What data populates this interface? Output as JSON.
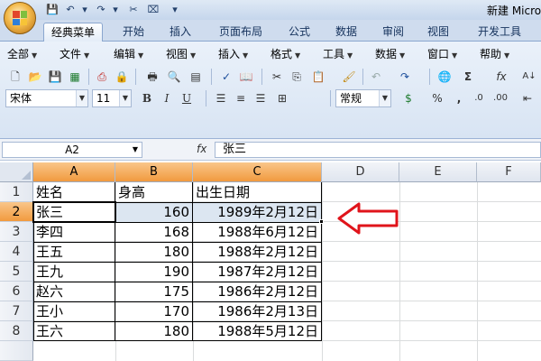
{
  "window": {
    "title": "新建 Micro"
  },
  "tabs": [
    "经典菜单",
    "开始",
    "插入",
    "页面布局",
    "公式",
    "数据",
    "审阅",
    "视图",
    "开发工具"
  ],
  "menus": [
    "全部",
    "文件",
    "编辑",
    "视图",
    "插入",
    "格式",
    "工具",
    "数据",
    "窗口",
    "帮助"
  ],
  "toolbar": {
    "font": "宋体",
    "size": "11",
    "bold": "B",
    "italic": "I",
    "underline": "U",
    "number_format": "常规",
    "percent": "%",
    "comma": ",",
    "fx": "fx"
  },
  "formula_bar": {
    "name_box": "A2",
    "fx_label": "fx",
    "value": "张三"
  },
  "grid": {
    "columns": [
      "A",
      "B",
      "C",
      "D",
      "E",
      "F"
    ],
    "rows": [
      "1",
      "2",
      "3",
      "4",
      "5",
      "6",
      "7",
      "8"
    ],
    "selected_cell": "A2",
    "data": [
      [
        "姓名",
        "身高",
        "出生日期"
      ],
      [
        "张三",
        "160",
        "1989年2月12日"
      ],
      [
        "李四",
        "168",
        "1988年6月12日"
      ],
      [
        "王五",
        "180",
        "1988年2月12日"
      ],
      [
        "王九",
        "190",
        "1987年2月12日"
      ],
      [
        "赵六",
        "175",
        "1986年2月12日"
      ],
      [
        "王小",
        "170",
        "1986年2月13日"
      ],
      [
        "王六",
        "180",
        "1988年5月12日"
      ]
    ]
  },
  "annotation": {
    "arrow_color": "#e0141b"
  }
}
